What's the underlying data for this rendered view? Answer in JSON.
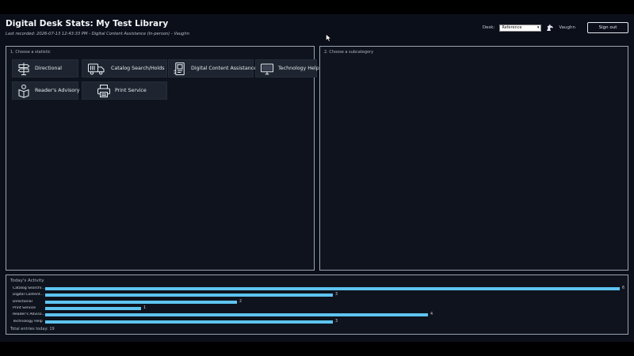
{
  "header": {
    "title": "Digital Desk Stats: My Test Library",
    "last_recorded": "Last recorded: 2026-07-13 12:43:33 PM - Digital Content Assistance (In-person) - Vaughn"
  },
  "desk": {
    "label": "Desk:",
    "selected": "Reference"
  },
  "user": {
    "name": "Vaughn",
    "icon": "unicorn-icon"
  },
  "signout_label": "Sign out",
  "left_panel": {
    "label": "1. Choose a statistic",
    "statistics": [
      {
        "label": "Directional",
        "icon": "signpost-icon"
      },
      {
        "label": "Catalog Search/Holds",
        "icon": "book-truck-icon"
      },
      {
        "label": "Digital Content Assistance",
        "icon": "ebook-icon",
        "info": "i"
      },
      {
        "label": "Technology Help",
        "icon": "monitor-icon"
      },
      {
        "label": "Reader's Advisory",
        "icon": "reader-icon"
      },
      {
        "label": "Print Service",
        "icon": "printer-icon"
      }
    ]
  },
  "right_panel": {
    "label": "2. Choose a subcategory"
  },
  "activity": {
    "title": "Today's Activity",
    "rows": [
      {
        "label": "Catalog Search/...",
        "count": "6",
        "value": 6
      },
      {
        "label": "Digital Content...",
        "count": "3",
        "value": 3
      },
      {
        "label": "Directional",
        "count": "2",
        "value": 2
      },
      {
        "label": "Print Service",
        "count": "1",
        "value": 1
      },
      {
        "label": "Reader's Adviso...",
        "count": "4",
        "value": 4
      },
      {
        "label": "Technology Help",
        "count": "3",
        "value": 3
      }
    ],
    "max_value": 6,
    "total": "Total entries today: 19"
  },
  "colors": {
    "bar": "#5ec4f0",
    "background": "#0b0f19",
    "button": "#1e2530"
  }
}
